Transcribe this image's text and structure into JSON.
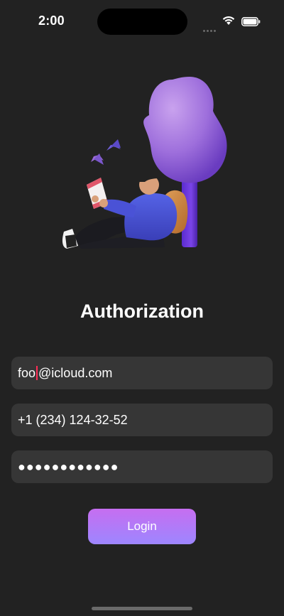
{
  "status_bar": {
    "time": "2:00",
    "icons": [
      "cellular-signal-icon",
      "wifi-icon",
      "battery-icon"
    ]
  },
  "illustration": {
    "icon": "person-reading-under-tree-illustration"
  },
  "form": {
    "title": "Authorization",
    "email_before_caret": "foo",
    "email_after_caret": "@icloud.com",
    "phone": "+1 (234) 124-32-52",
    "password_masked": "●●●●●●●●●●●●",
    "login_label": "Login"
  },
  "colors": {
    "background": "#222222",
    "field": "#363636",
    "caret": "#ff2d55",
    "button_top": "#c66ef0",
    "button_bottom": "#9d86ff"
  }
}
